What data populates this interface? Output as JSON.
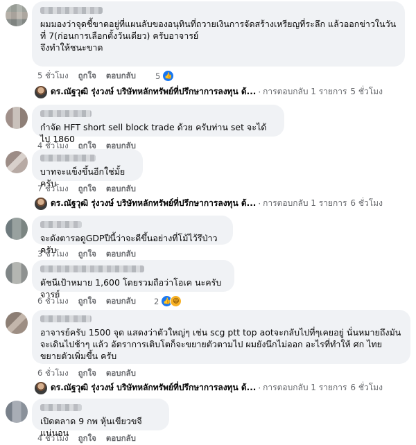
{
  "comments": [
    {
      "text": "ผมมองว่าจุดชี้ขาดอยู่ที่แผนลับของอนุทินที่ถวายเงินการจัดสร้างเหรียญที่ระลึก แล้วออกข่าวในวันที่ 7(ก่อนการเลือกตั้งวันเดียว) ครับอาจารย์\nจึงทำให้ชนะขาด",
      "time": "5 ชั่วโมง",
      "like": "ถูกใจ",
      "reply": "ตอบกลับ",
      "reaction_count": "5"
    },
    {
      "text": "กำจัด HFT short sell block trade ด้วย ครับท่าน set จะได้ไป 1860",
      "time": "4 ชั่วโมง",
      "like": "ถูกใจ",
      "reply": "ตอบกลับ"
    },
    {
      "text": "บาทจะแข็งขึ้นอีกใช่มั้ยครับ",
      "time": "7 ชั่วโมง",
      "like": "ถูกใจ",
      "reply": "ตอบกลับ"
    },
    {
      "text": "จะดังตารอดูGDPปีนี้ว่าจะดีขึ้นอย่างที่โม้ไว้รึป่าวครับ",
      "time": "3 ชั่วโมง",
      "like": "ถูกใจ",
      "reply": "ตอบกลับ"
    },
    {
      "text": "ดัชนีเป้าหมาย 1,600 โดยรวมถือว่าโอเค นะครับจารย์",
      "time": "6 ชั่วโมง",
      "like": "ถูกใจ",
      "reply": "ตอบกลับ",
      "reaction_count": "2"
    },
    {
      "text": "อาจารย์ครับ 1500 จุด แสดงว่าตัวใหญ่ๆ เช่น scg ptt top aotจะกลับไปที่ๆเคยอยู่ นั่นหมายถึงมันจะเดินไปช้าๆ แล้ว อัตราการเติบโตก็จะขยายตัวตามไป ผมยังนึกไม่ออก อะไรที่ทำให้ ศก ไทย ขยายตัวเพิ่มขึ้น ครับ",
      "time": "6 ชั่วโมง",
      "like": "ถูกใจ",
      "reply": "ตอบกลับ"
    },
    {
      "text": "เปิดตลาด 9 กพ หุ้นเขียวขจีแน่นอน",
      "time": "4 ชั่วโมง",
      "like": "ถูกใจ",
      "reply": "ตอบกลับ"
    }
  ],
  "replies": [
    {
      "name": "ดร.ณัฐวุฒิ รุ่งวงษ์ บริษัทหลักทรัพย์ที่ปรึกษาการลงทุน ด้...",
      "dot": "·",
      "label": "การตอบกลับ 1 รายการ",
      "time": "5 ชั่วโมง"
    },
    {
      "name": "ดร.ณัฐวุฒิ รุ่งวงษ์ บริษัทหลักทรัพย์ที่ปรึกษาการลงทุน ด้...",
      "dot": "·",
      "label": "การตอบกลับ 1 รายการ",
      "time": "6 ชั่วโมง"
    },
    {
      "name": "ดร.ณัฐวุฒิ รุ่งวงษ์ บริษัทหลักทรัพย์ที่ปรึกษาการลงทุน ด้...",
      "dot": "·",
      "label": "การตอบกลับ 1 รายการ",
      "time": "6 ชั่วโมง"
    }
  ],
  "icons": {
    "like": "like-icon",
    "haha": "haha-icon"
  },
  "colors": {
    "bubble": "#f0f2f5",
    "meta": "#65676b",
    "like_blue": "#1877f2"
  }
}
